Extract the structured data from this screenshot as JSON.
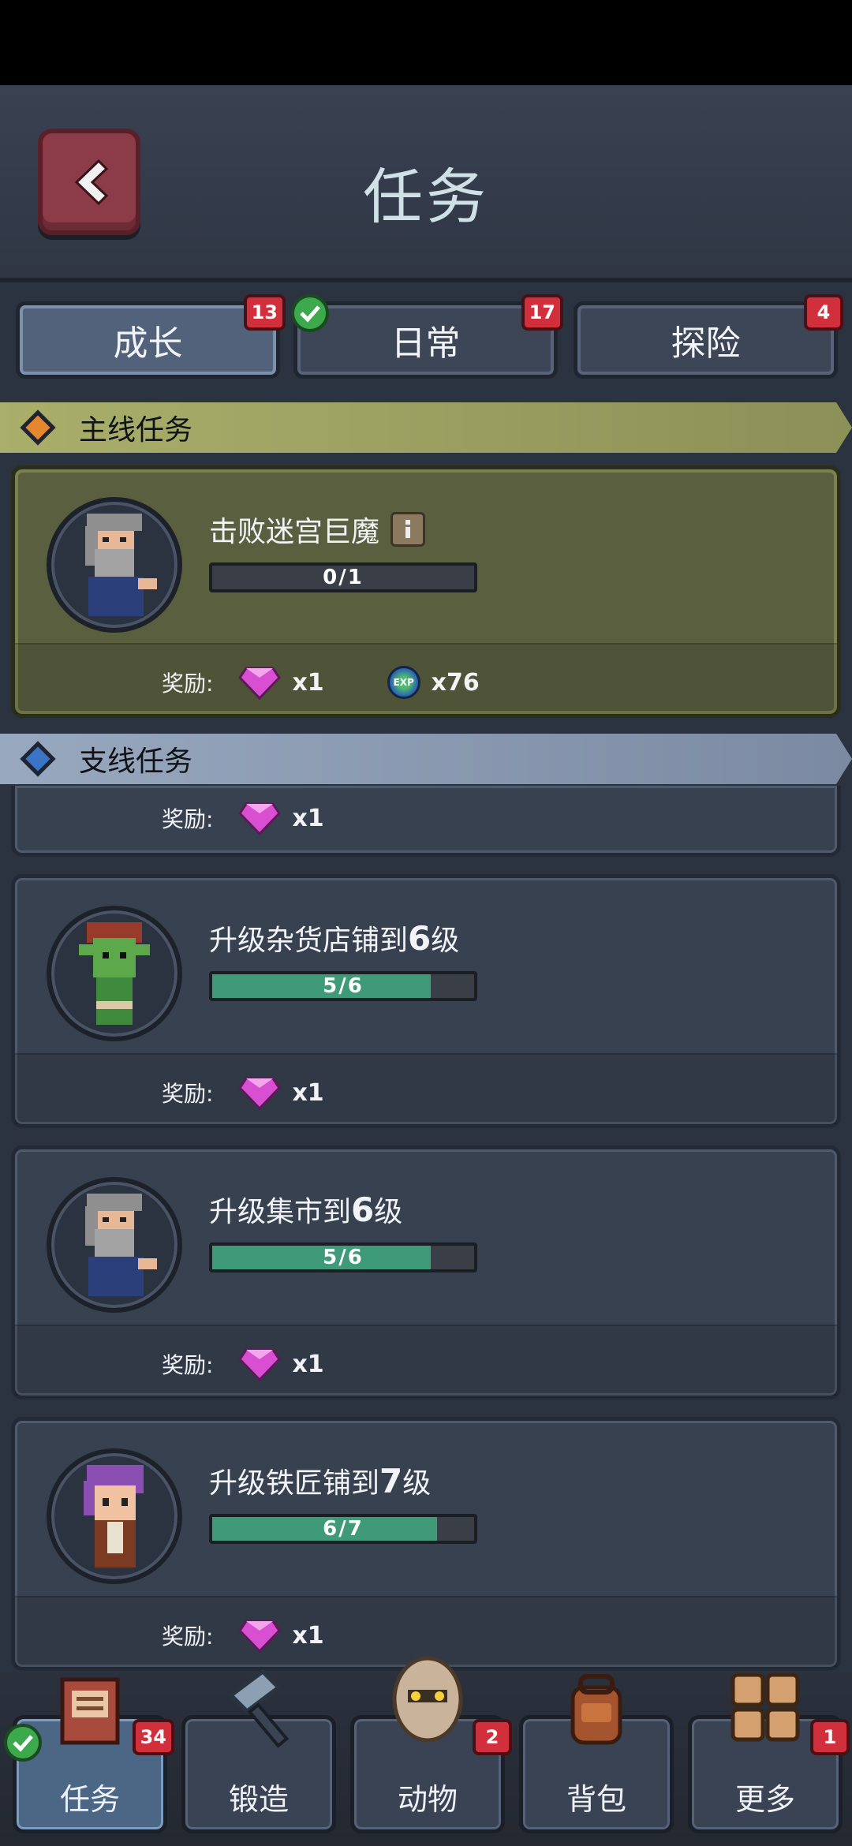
{
  "header": {
    "title": "任务"
  },
  "tabs": [
    {
      "label": "成长",
      "badge": "13",
      "active": true
    },
    {
      "label": "日常",
      "badge": "17",
      "checked": true
    },
    {
      "label": "探险",
      "badge": "4"
    }
  ],
  "sections": {
    "main": {
      "title": "主线任务"
    },
    "side": {
      "title": "支线任务"
    }
  },
  "reward_label": "奖励:",
  "main_task": {
    "title": "击败迷宫巨魔",
    "progress_text": "0/1",
    "progress": 0.0,
    "rewards": [
      {
        "icon": "gem-icon",
        "count": "x1"
      },
      {
        "icon": "exp-orb-icon",
        "count": "x76",
        "label": "EXP"
      }
    ]
  },
  "partial_task": {
    "reward_count": "x1"
  },
  "side_tasks": [
    {
      "avatar": "goblin-avatar",
      "title_prefix": "升级杂货店铺到",
      "level": "6",
      "title_suffix": "级",
      "progress_text": "5/6",
      "progress": 0.833,
      "reward_count": "x1"
    },
    {
      "avatar": "old-man-avatar",
      "title_prefix": "升级集市到",
      "level": "6",
      "title_suffix": "级",
      "progress_text": "5/6",
      "progress": 0.833,
      "reward_count": "x1"
    },
    {
      "avatar": "purple-hair-avatar",
      "title_prefix": "升级铁匠铺到",
      "level": "7",
      "title_suffix": "级",
      "progress_text": "6/7",
      "progress": 0.857,
      "reward_count": "x1"
    }
  ],
  "bottom_nav": [
    {
      "label": "任务",
      "badge": "34",
      "active": true,
      "checked": true,
      "icon": "book-icon"
    },
    {
      "label": "锻造",
      "icon": "hammer-icon"
    },
    {
      "label": "动物",
      "badge": "2",
      "icon": "egg-icon"
    },
    {
      "label": "背包",
      "icon": "backpack-icon"
    },
    {
      "label": "更多",
      "badge": "1",
      "icon": "grid-icon"
    }
  ],
  "colors": {
    "main_section": "#a9af6a",
    "side_section": "#98a8bf",
    "badge": "#d12f3c",
    "progress": "#3e9a78",
    "check": "#3caa4c"
  }
}
